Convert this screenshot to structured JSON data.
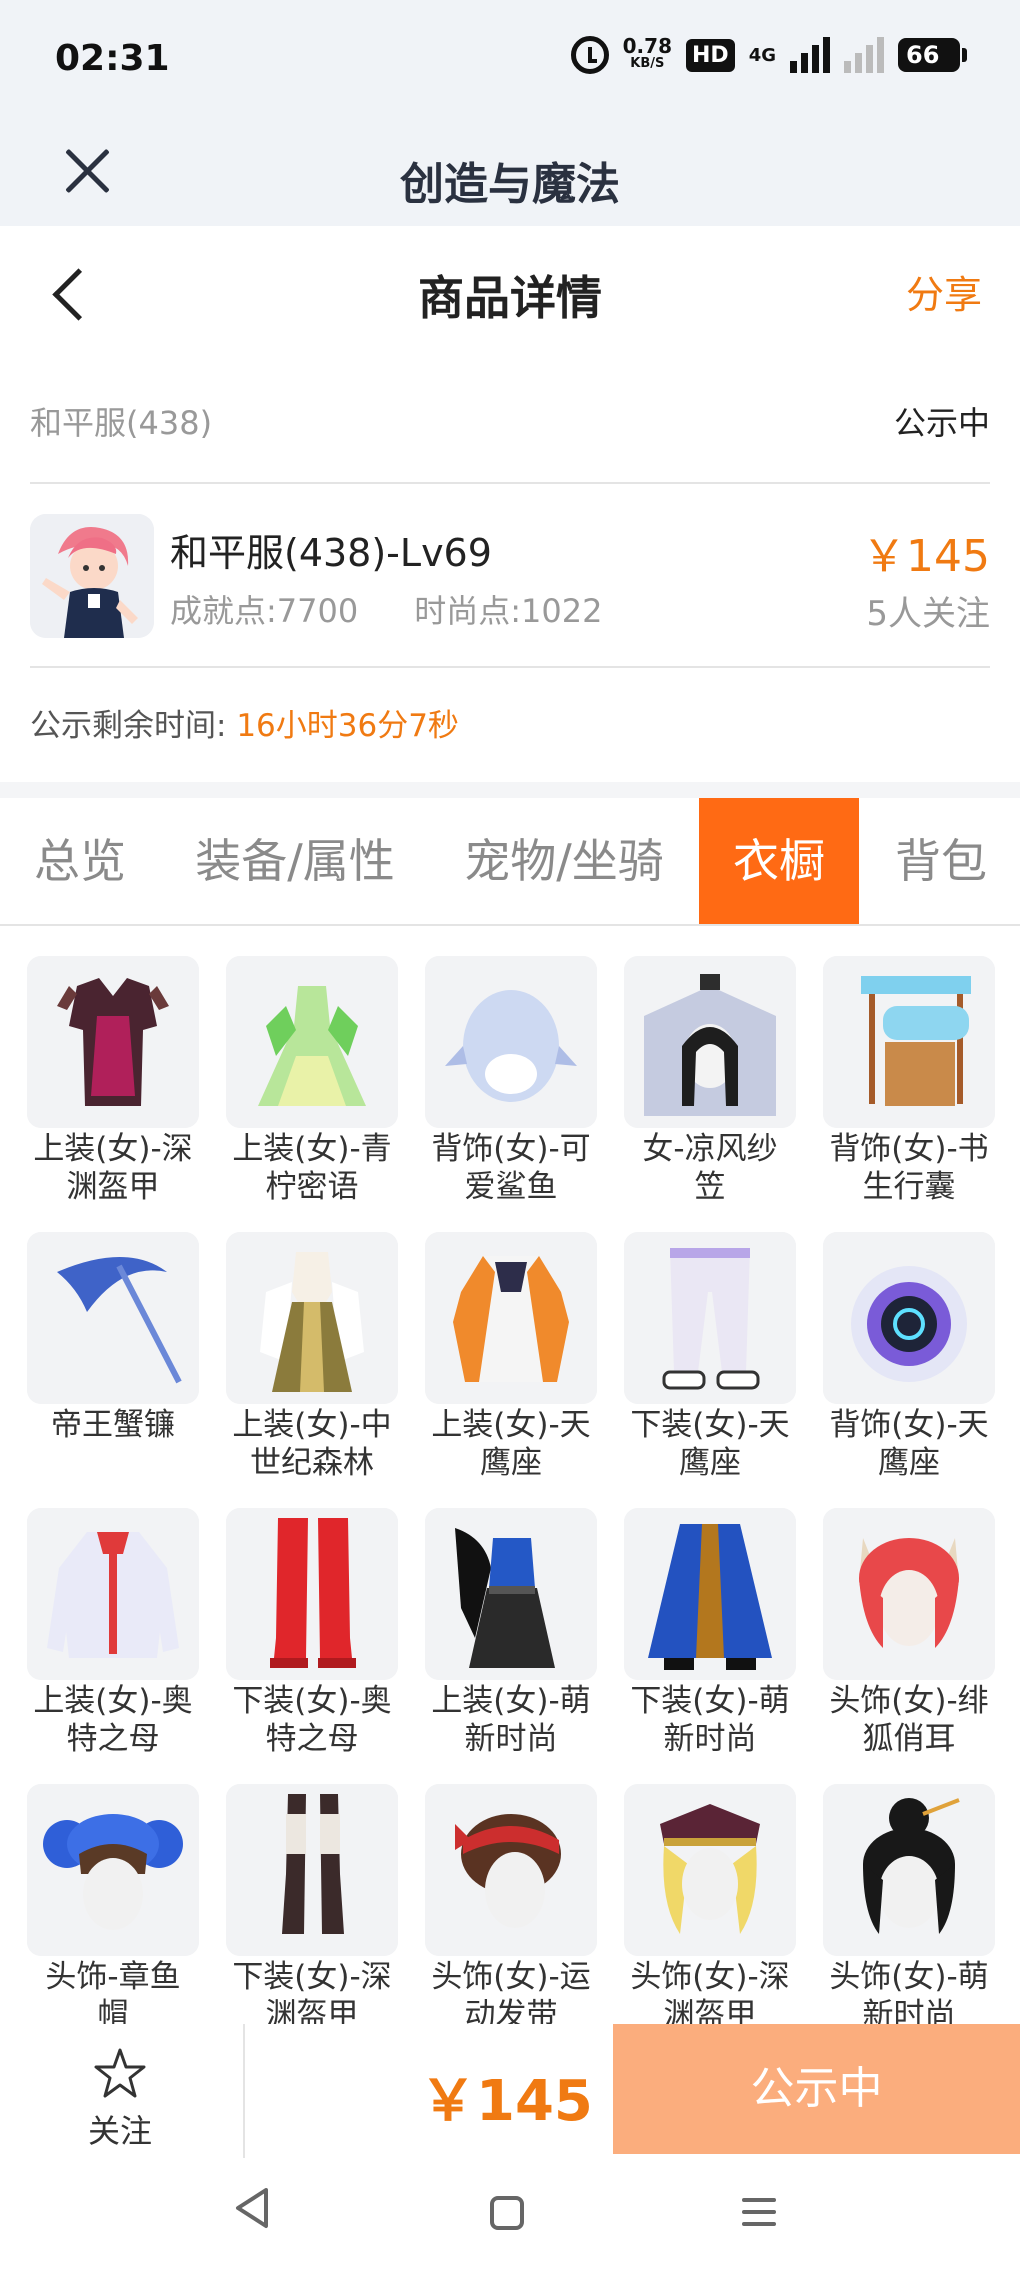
{
  "status_bar": {
    "time": "02:31",
    "net_speed": "0.78",
    "net_unit": "KB/S",
    "hd": "HD",
    "network": "4G",
    "battery": "66"
  },
  "app": {
    "title": "创造与魔法",
    "close_icon": "close-icon"
  },
  "page": {
    "title": "商品详情",
    "share": "分享"
  },
  "info": {
    "server": "和平服(438)",
    "status": "公示中",
    "role_name": "和平服(438)-Lv69",
    "achievement": "成就点:7700",
    "fashion": "时尚点:1022",
    "price": "￥145",
    "follows": "5人关注",
    "remain_label": "公示剩余时间:",
    "remain_value": "16小时36分7秒"
  },
  "tabs": [
    {
      "label": "总览",
      "active": false
    },
    {
      "label": "装备/属性",
      "active": false
    },
    {
      "label": "宠物/坐骑",
      "active": false
    },
    {
      "label": "衣橱",
      "active": true
    },
    {
      "label": "背包",
      "active": false
    }
  ],
  "items": [
    {
      "line1": "上装(女)-深",
      "line2": "渊盔甲",
      "icon": "armor-icon"
    },
    {
      "line1": "上装(女)-青",
      "line2": "柠密语",
      "icon": "dress-icon"
    },
    {
      "line1": "背饰(女)-可",
      "line2": "爱鲨鱼",
      "icon": "shark-icon"
    },
    {
      "line1": "女-凉风纱",
      "line2": "笠",
      "icon": "veil-hat-icon"
    },
    {
      "line1": "背饰(女)-书",
      "line2": "生行囊",
      "icon": "backpack-icon"
    },
    {
      "line1": "帝王蟹镰",
      "line2": "",
      "icon": "scythe-icon"
    },
    {
      "line1": "上装(女)-中",
      "line2": "世纪森林",
      "icon": "dress-icon"
    },
    {
      "line1": "上装(女)-天",
      "line2": "鹰座",
      "icon": "jacket-icon"
    },
    {
      "line1": "下装(女)-天",
      "line2": "鹰座",
      "icon": "pants-icon"
    },
    {
      "line1": "背饰(女)-天",
      "line2": "鹰座",
      "icon": "helmet-icon"
    },
    {
      "line1": "上装(女)-奥",
      "line2": "特之母",
      "icon": "shirt-icon"
    },
    {
      "line1": "下装(女)-奥",
      "line2": "特之母",
      "icon": "boots-icon"
    },
    {
      "line1": "上装(女)-萌",
      "line2": "新时尚",
      "icon": "dress-icon"
    },
    {
      "line1": "下装(女)-萌",
      "line2": "新时尚",
      "icon": "skirt-icon"
    },
    {
      "line1": "头饰(女)-绯",
      "line2": "狐俏耳",
      "icon": "fox-ears-icon"
    },
    {
      "line1": "头饰-章鱼",
      "line2": "帽",
      "icon": "octopus-hat-icon"
    },
    {
      "line1": "下装(女)-深",
      "line2": "渊盔甲",
      "icon": "boots-icon"
    },
    {
      "line1": "头饰(女)-运",
      "line2": "动发带",
      "icon": "headband-icon"
    },
    {
      "line1": "头饰(女)-深",
      "line2": "渊盔甲",
      "icon": "hat-icon"
    },
    {
      "line1": "头饰(女)-萌",
      "line2": "新时尚",
      "icon": "hair-bun-icon"
    }
  ],
  "bottom": {
    "follow_label": "关注",
    "price": "￥145",
    "button": "公示中"
  },
  "colors": {
    "accent": "#f07a12",
    "tab_active": "#ff6a14",
    "button_disabled": "#fbad7d"
  }
}
